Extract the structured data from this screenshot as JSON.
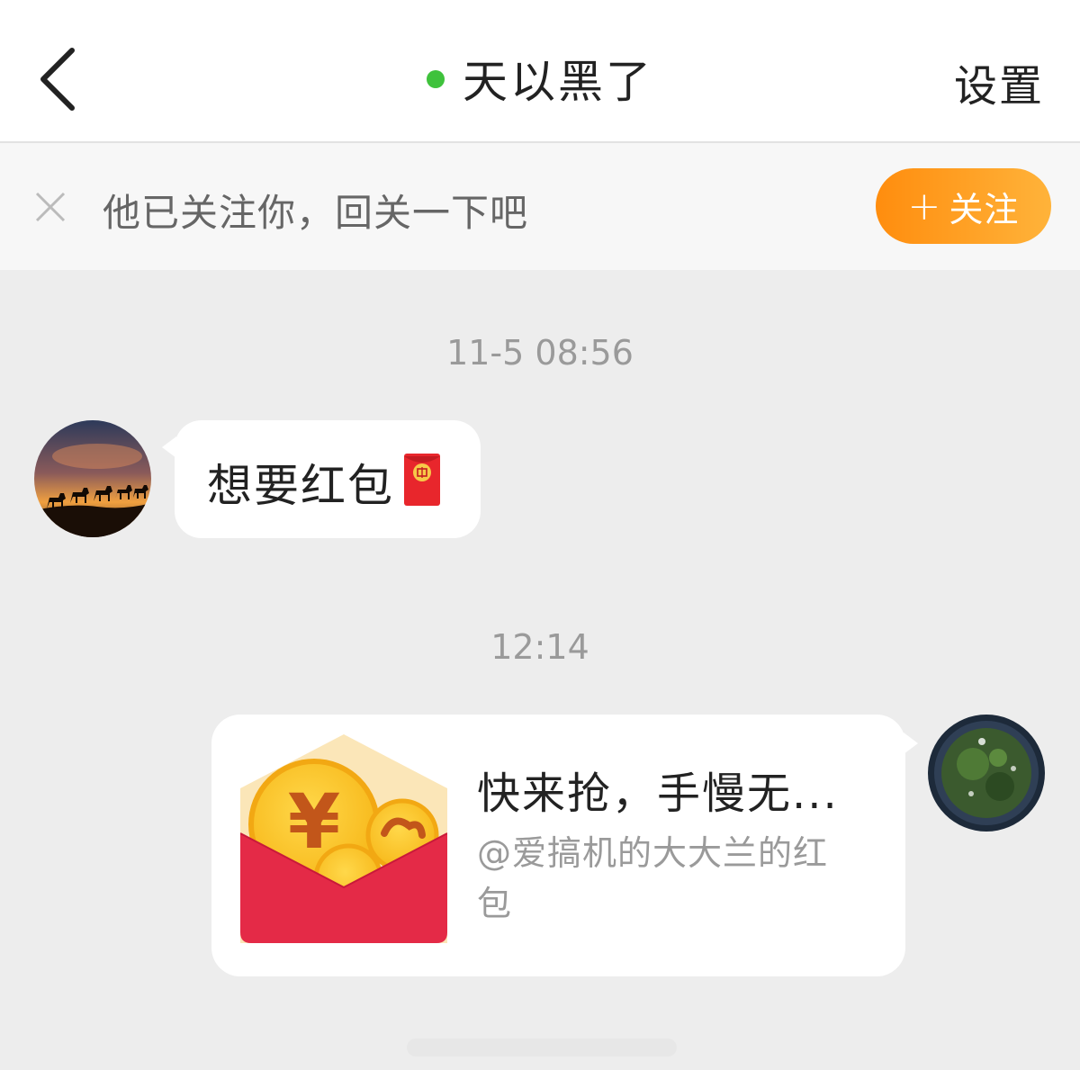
{
  "header": {
    "title": "天以黑了",
    "settings_label": "设置",
    "online_color": "#3fc23c"
  },
  "follow_banner": {
    "text": "他已关注你，回关一下吧",
    "button_label": "关注",
    "button_plus": "+",
    "accent_color": "#ff9a1a"
  },
  "messages": [
    {
      "timestamp": "11-5 08:56",
      "direction": "incoming",
      "text": "想要红包",
      "emoji": "red-envelope-emoji"
    },
    {
      "timestamp": "12:14",
      "direction": "outgoing",
      "card": {
        "title": "快来抢，手慢无...",
        "subtitle": "@爱搞机的大大兰的红包",
        "image": "red-envelope-icon"
      }
    }
  ]
}
